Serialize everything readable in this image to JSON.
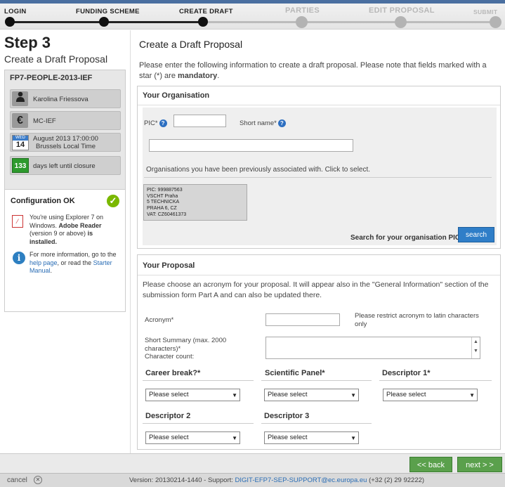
{
  "wizard": {
    "steps": [
      {
        "label": "LOGIN",
        "state": "done"
      },
      {
        "label": "FUNDING SCHEME",
        "state": "done"
      },
      {
        "label": "CREATE DRAFT",
        "state": "current"
      },
      {
        "label": "PARTIES",
        "state": "todo"
      },
      {
        "label": "EDIT PROPOSAL",
        "state": "todo"
      },
      {
        "label": "SUBMIT",
        "state": "todo"
      }
    ]
  },
  "sidebar": {
    "step_title": "Step 3",
    "step_subtitle": "Create a Draft Proposal",
    "call_id": "FP7-PEOPLE-2013-IEF",
    "user": "Karolina Friessova",
    "funding_scheme": "MC-IEF",
    "calendar_month": "WED",
    "calendar_day": "14",
    "deadline_line1": "August 2013 17:00:00",
    "deadline_line2": "Brussels Local Time",
    "days_left": "133",
    "days_left_label": "days left until closure",
    "config_title": "Configuration OK",
    "config_text_1": "You're using Explorer 7 on Windows.",
    "config_text_reader": "Adobe Reader",
    "config_text_2": "(version 9 or above)",
    "config_text_3": "is installed.",
    "more_info_1": "For more information, go to the",
    "help_link": "help page",
    "more_info_2": ", or read the",
    "starter_link": "Starter Manual",
    "more_info_3": "."
  },
  "main": {
    "title": "Create a Draft Proposal",
    "intro_1": "Please enter the following information to create a draft proposal. Please note that fields marked with a star (*) are ",
    "intro_mandatory": "mandatory",
    "intro_2": ".",
    "organisation": {
      "title": "Your Organisation",
      "pic_label": "PIC*",
      "short_name_label": "Short name*",
      "pic_value": "",
      "short_name_value": "",
      "previous_text": "Organisations you have been previously associated with. Click to select.",
      "card": [
        "PIC: 999887563",
        "VSCHT Praha",
        "5 TECHNICKA",
        "PRAHA 6, CZ",
        "VAT: CZ60461373"
      ],
      "search_label": "Search for your organisation PIC",
      "search_button": "search"
    },
    "proposal": {
      "title": "Your Proposal",
      "intro": "Please choose an acronym for your proposal. It will appear also in the \"General Information\" section of the submission form Part A and can also be updated there.",
      "acronym_label": "Acronym*",
      "acronym_hint": "Please restrict acronym to latin characters only",
      "summary_label_1": "Short Summary (max. 2000",
      "summary_label_2": "characters)*",
      "summary_label_3": "Character count:",
      "career_break": "Career break?*",
      "scientific_panel": "Scientific Panel*",
      "descriptor1": "Descriptor 1*",
      "descriptor2": "Descriptor 2",
      "descriptor3": "Descriptor 3",
      "select_placeholder": "Please select"
    }
  },
  "footer": {
    "back": "<< back",
    "next": "next > >",
    "cancel": "cancel",
    "version_text": "Version: 20130214-1440 - Support: ",
    "support_email": "DIGIT-EFP7-SEP-SUPPORT@ec.europa.eu",
    "phone": " (+32 (2) 29 92222)"
  }
}
